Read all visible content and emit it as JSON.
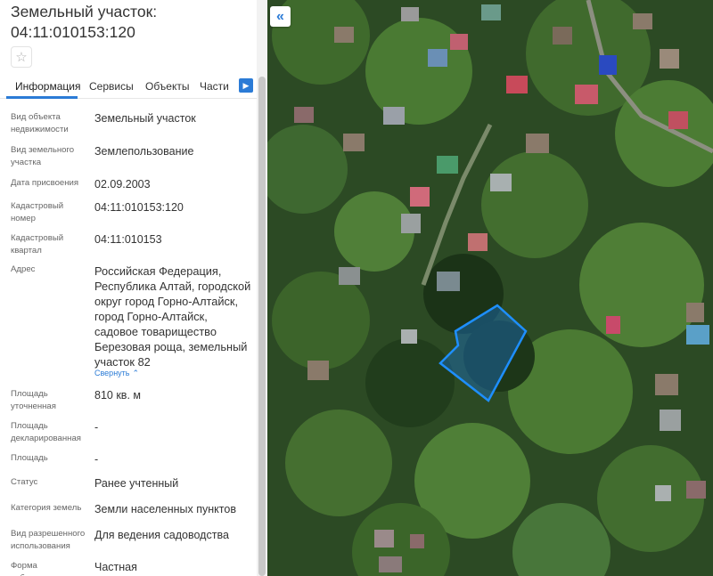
{
  "parcel": {
    "title_line1": "Земельный участок:",
    "title_line2": "04:11:010153:120"
  },
  "tabs": [
    "Информация",
    "Сервисы",
    "Объекты",
    "Части ЗУ"
  ],
  "properties": [
    {
      "label": "Вид объекта недвижимости",
      "value": "Земельный участок"
    },
    {
      "label": "Вид земельного участка",
      "value": "Землепользование"
    },
    {
      "label": "Дата присвоения",
      "value": "02.09.2003"
    },
    {
      "label": "Кадастровый номер",
      "value": "04:11:010153:120"
    },
    {
      "label": "Кадастровый квартал",
      "value": "04:11:010153"
    },
    {
      "label": "Адрес",
      "value": "Российская Федерация, Республика Алтай, городской округ город Горно-Алтайск, город Горно-Алтайск, садовое товарищество Березовая роща, земельный участок 82"
    },
    {
      "label": "Площадь уточненная",
      "value": "810 кв. м"
    },
    {
      "label": "Площадь декларированная",
      "value": "-"
    },
    {
      "label": "Площадь",
      "value": "-"
    },
    {
      "label": "Статус",
      "value": "Ранее учтенный"
    },
    {
      "label": "Категория земель",
      "value": "Земли населенных пунктов"
    },
    {
      "label": "Вид разрешенного использования",
      "value": "Для ведения садоводства"
    },
    {
      "label": "Форма собственности",
      "value": "Частная"
    }
  ],
  "collapse_label": "Свернуть",
  "icons": {
    "favorite": "star-outline-icon",
    "tabs_scroll": "chevron-right-icon",
    "collapse_panel": "double-chevron-left-icon",
    "collapse_address": "chevron-up-icon"
  },
  "colors": {
    "accent": "#2b7bd6",
    "parcel_outline": "#1e8fff",
    "parcel_fill": "#1a6fc0"
  }
}
